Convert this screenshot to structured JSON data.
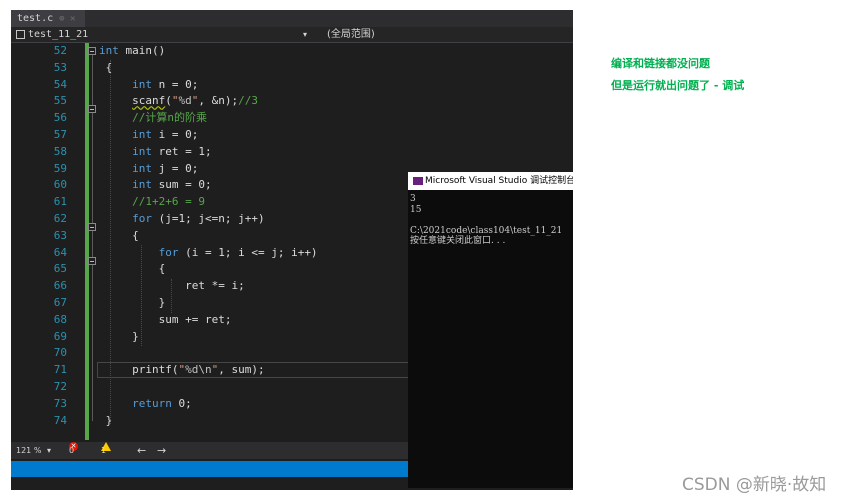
{
  "tab": {
    "filename": "test.c",
    "icons": "⊕ ✕"
  },
  "nav": {
    "project": "test_11_21",
    "scope": "(全局范围)"
  },
  "line_numbers": [
    "52",
    "53",
    "54",
    "55",
    "56",
    "57",
    "58",
    "59",
    "60",
    "61",
    "62",
    "63",
    "64",
    "65",
    "66",
    "67",
    "68",
    "69",
    "70",
    "71",
    "72",
    "73",
    "74"
  ],
  "code": {
    "l52": {
      "kw": "int",
      "rest": " main()"
    },
    "l53": "{",
    "l54": {
      "kw": "int",
      "rest": " n = 0;"
    },
    "l55": {
      "fn": "scanf",
      "p1": "(",
      "str1": "\"",
      "fmt": "%d",
      "str2": "\"",
      "rest": ", &n);",
      "cm": "//3"
    },
    "l56": "//计算n的阶乘",
    "l57": {
      "kw": "int",
      "rest": " i = 0;"
    },
    "l58": {
      "kw": "int",
      "rest": " ret = 1;"
    },
    "l59": {
      "kw": "int",
      "rest": " j = 0;"
    },
    "l60": {
      "kw": "int",
      "rest": " sum = 0;"
    },
    "l61": "//1+2+6 = 9",
    "l62": {
      "kw": "for",
      "rest": " (j=1; j<=n; j++)"
    },
    "l63": "{",
    "l64": {
      "kw": "for",
      "rest": " (i = 1; i <= j; i++)"
    },
    "l65": "{",
    "l66": "ret *= i;",
    "l67": "}",
    "l68": "sum += ret;",
    "l69": "}",
    "l71": {
      "fn": "printf",
      "p1": "(",
      "str1": "\"",
      "fmt": "%d\\n",
      "str2": "\"",
      "rest": ", sum);"
    },
    "l73": {
      "kw": "return",
      "rest": " 0;"
    },
    "l74": "}"
  },
  "status": {
    "zoom": "121 %",
    "errors": "0",
    "warnings": "1",
    "nav_back": "←",
    "nav_fwd": "→"
  },
  "console": {
    "title": "Microsoft Visual Studio 调试控制台",
    "output": "3\n15\n\nC:\\2021code\\class104\\test_11_21\n按任意键关闭此窗口. . ."
  },
  "notes": {
    "line1": "编译和链接都没问题",
    "line2": "但是运行就出问题了 - 调试"
  },
  "watermark": "CSDN @新晓·故知"
}
